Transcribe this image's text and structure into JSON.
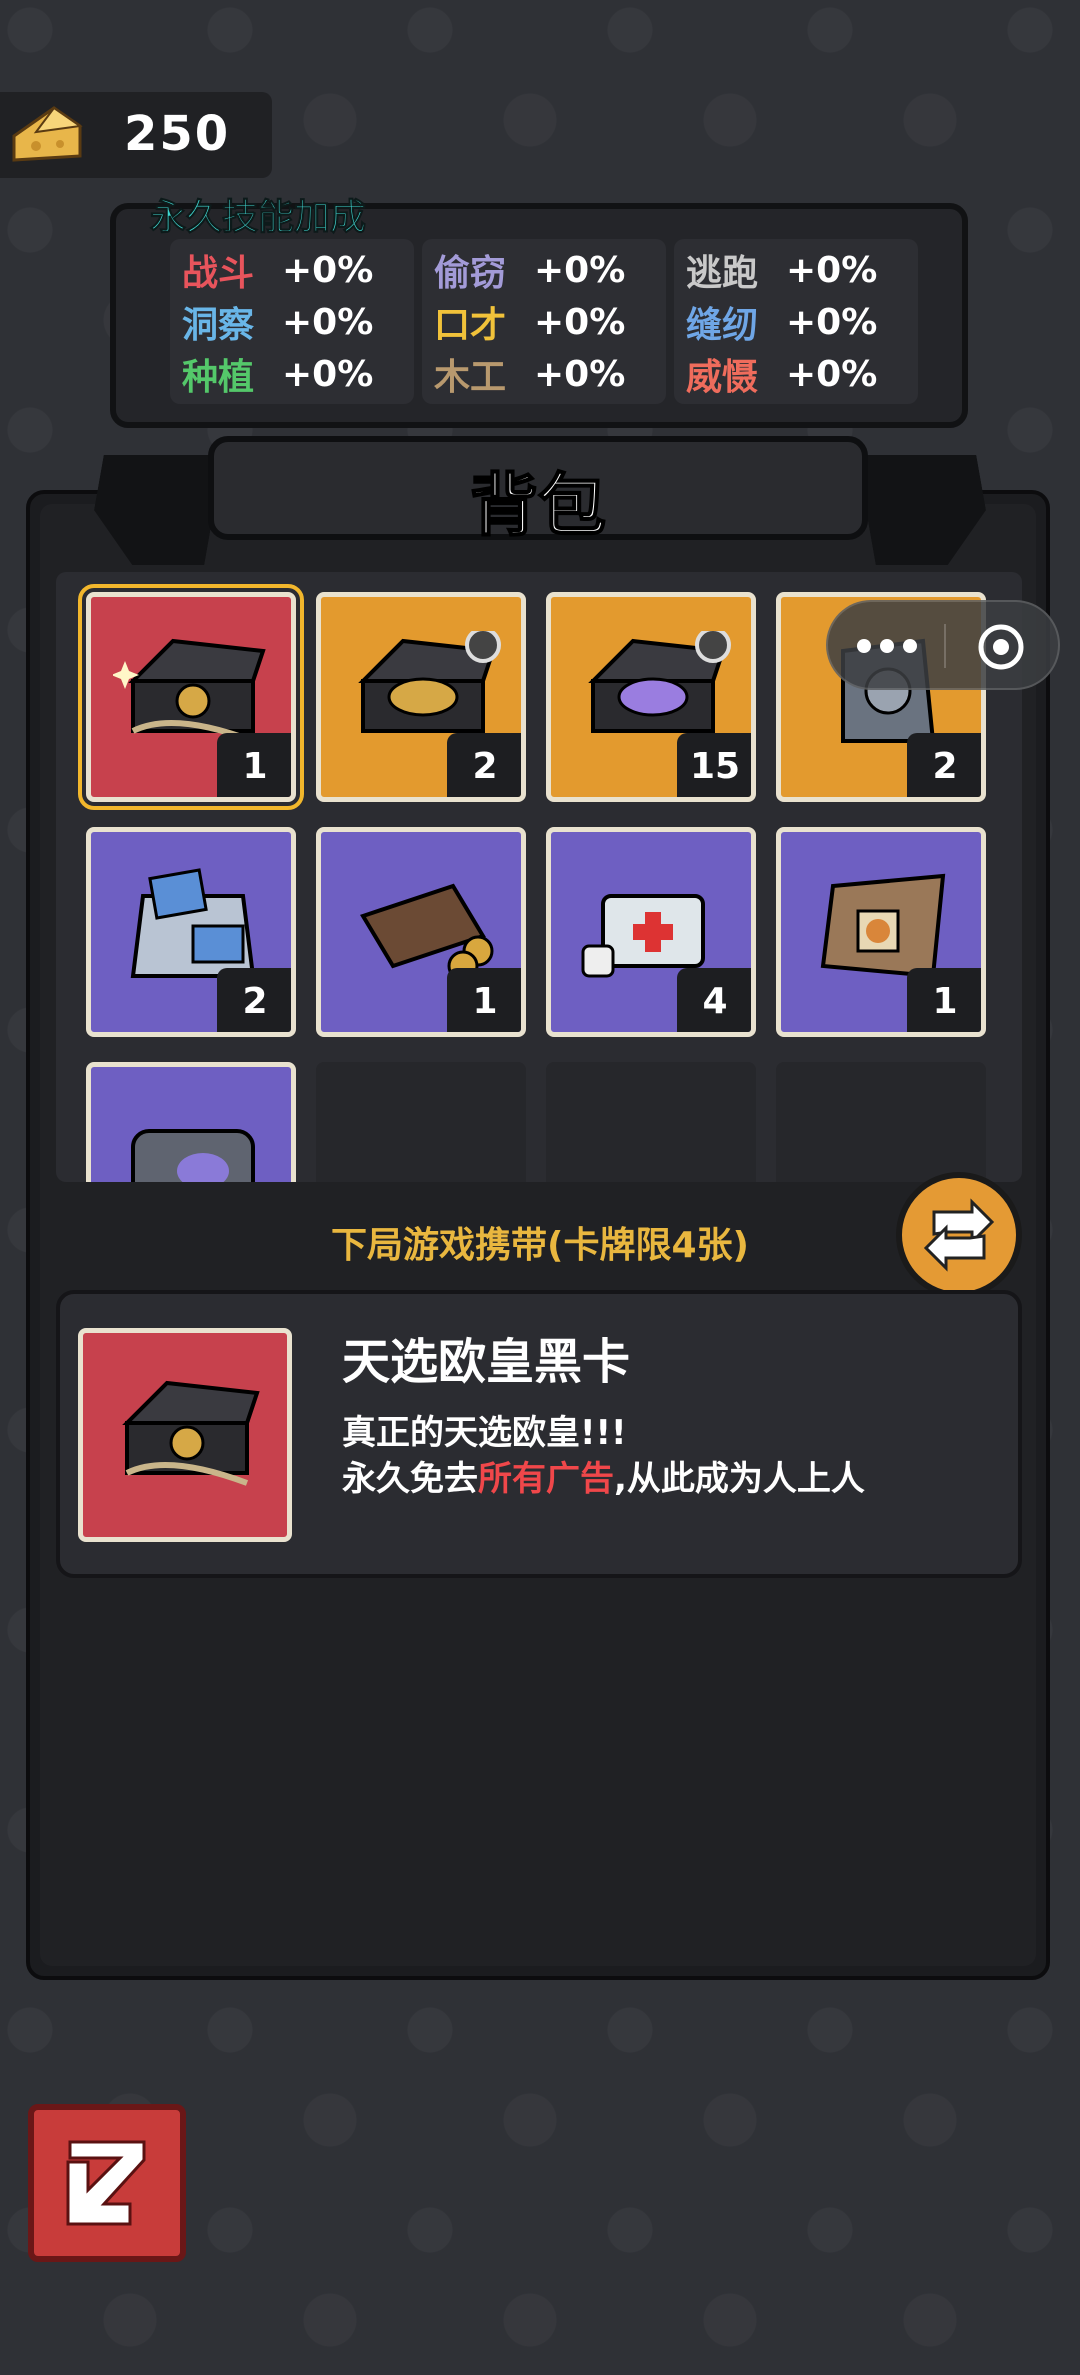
{
  "currency": {
    "icon": "cheese-icon",
    "value": "250"
  },
  "skills": {
    "title": "永久技能加成",
    "columns": [
      [
        {
          "name": "战斗",
          "value": "+0%",
          "color": "#e8545c"
        },
        {
          "name": "洞察",
          "value": "+0%",
          "color": "#69b6e8"
        },
        {
          "name": "种植",
          "value": "+0%",
          "color": "#54c86a"
        }
      ],
      [
        {
          "name": "偷窃",
          "value": "+0%",
          "color": "#a39bd8"
        },
        {
          "name": "口才",
          "value": "+0%",
          "color": "#f1c23a"
        },
        {
          "name": "木工",
          "value": "+0%",
          "color": "#b8996e"
        }
      ],
      [
        {
          "name": "逃跑",
          "value": "+0%",
          "color": "#c9c9c9"
        },
        {
          "name": "缝纫",
          "value": "+0%",
          "color": "#6fa6e6"
        },
        {
          "name": "威慑",
          "value": "+0%",
          "color": "#ef6c5c"
        }
      ]
    ]
  },
  "bag": {
    "title": "背包",
    "items": [
      {
        "name": "black-card-giftbox",
        "color": "red",
        "count": "1",
        "selected": true
      },
      {
        "name": "gold-card-giftbox",
        "color": "orange",
        "count": "2"
      },
      {
        "name": "purple-card-giftbox",
        "color": "orange",
        "count": "15"
      },
      {
        "name": "gray-cat-figure",
        "color": "orange",
        "count": "2"
      },
      {
        "name": "blue-ticket-bag",
        "color": "purple",
        "count": "2"
      },
      {
        "name": "wallet-coins",
        "color": "purple",
        "count": "1"
      },
      {
        "name": "first-aid-kit",
        "color": "purple",
        "count": "4"
      },
      {
        "name": "paper-bag-cookie",
        "color": "purple",
        "count": "1"
      },
      {
        "name": "metal-case",
        "color": "purple",
        "count": ""
      }
    ]
  },
  "carry": {
    "label": "下局游戏携带(卡牌限4张)"
  },
  "detail": {
    "title": "天选欧皇黑卡",
    "line1": "真正的天选欧皇!!!",
    "line2_pre": "永久免去",
    "line2_hl": "所有广告",
    "line2_post": ",从此成为人上人"
  },
  "colors": {
    "accent": "#f2b72c",
    "highlight": "#f0474a",
    "title_teal": "#3fd6d0",
    "carry_label": "#e9b73f"
  }
}
